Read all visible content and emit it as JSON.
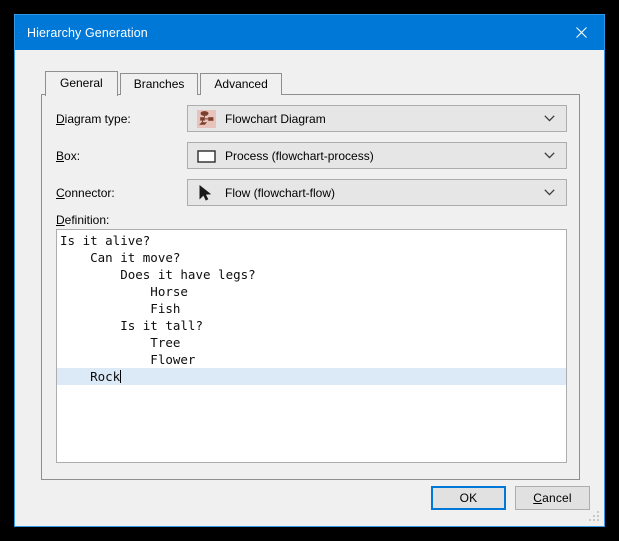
{
  "window": {
    "title": "Hierarchy Generation",
    "accent_color": "#0078d7",
    "close_icon": "close-icon"
  },
  "tabs": [
    {
      "label": "General",
      "selected": true
    },
    {
      "label": "Branches",
      "selected": false
    },
    {
      "label": "Advanced",
      "selected": false
    }
  ],
  "fields": {
    "diagram_type": {
      "label": "Diagram type:",
      "accel": "D",
      "value": "Flowchart Diagram",
      "icon": "flowchart-diagram-icon"
    },
    "box": {
      "label": "Box:",
      "accel": "B",
      "value": "Process (flowchart-process)",
      "icon": "process-rectangle-icon"
    },
    "connector": {
      "label": "Connector:",
      "accel": "C",
      "value": "Flow (flowchart-flow)",
      "icon": "arrow-cursor-icon"
    }
  },
  "definition": {
    "label": "Definition:",
    "accel": "D",
    "selection_color": "#dceaf8",
    "lines": [
      {
        "text": "Is it alive?",
        "indent": 0,
        "selected": false
      },
      {
        "text": "    Can it move?",
        "indent": 4,
        "selected": false
      },
      {
        "text": "        Does it have legs?",
        "indent": 8,
        "selected": false
      },
      {
        "text": "            Horse",
        "indent": 12,
        "selected": false
      },
      {
        "text": "            Fish",
        "indent": 12,
        "selected": false
      },
      {
        "text": "        Is it tall?",
        "indent": 8,
        "selected": false
      },
      {
        "text": "            Tree",
        "indent": 12,
        "selected": false
      },
      {
        "text": "            Flower",
        "indent": 12,
        "selected": false
      },
      {
        "text": "    Rock",
        "indent": 4,
        "selected": true
      }
    ]
  },
  "buttons": {
    "ok": {
      "label": "OK",
      "default": true
    },
    "cancel": {
      "label": "Cancel",
      "accel": "C"
    }
  }
}
